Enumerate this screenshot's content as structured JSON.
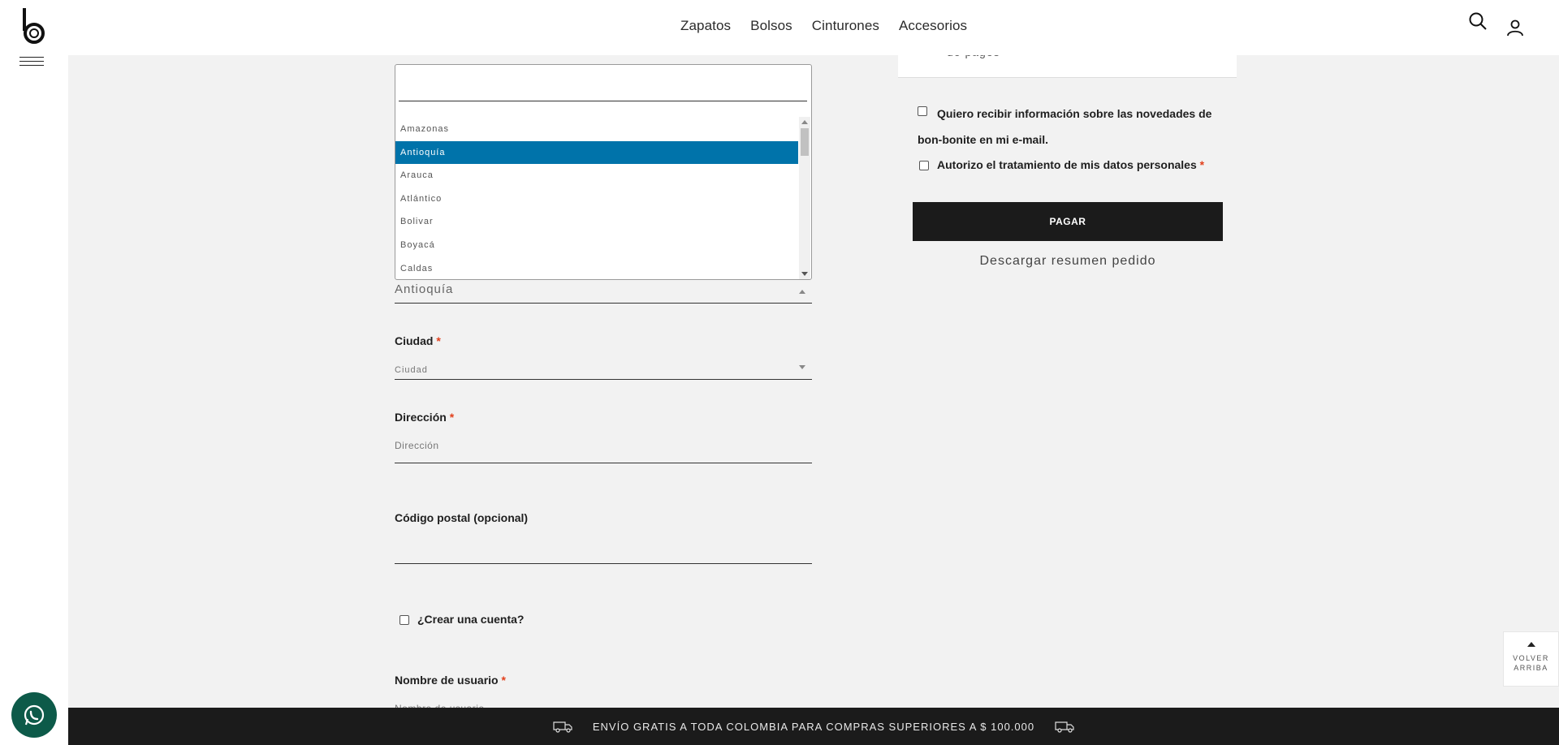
{
  "nav": {
    "items": [
      "Zapatos",
      "Bolsos",
      "Cinturones",
      "Accesorios"
    ]
  },
  "dropdown": {
    "options": [
      "Amazonas",
      "Antioquía",
      "Arauca",
      "Atlántico",
      "Bolivar",
      "Boyacá",
      "Caldas"
    ],
    "active_index": 1
  },
  "form": {
    "departamento_value": "Antioquía",
    "ciudad_label": "Ciudad",
    "ciudad_value": "Ciudad",
    "direccion_label": "Dirección",
    "direccion_placeholder": "Dirección",
    "postal_label": "Código postal (opcional)",
    "crear_cuenta": "¿Crear una cuenta?",
    "usuario_label": "Nombre de usuario",
    "usuario_placeholder": "Nombre de usuario",
    "required_mark": "*"
  },
  "summary": {
    "partial_text": "de pagos",
    "newsletter": "Quiero recibir información sobre las novedades de bon-bonite en mi e-mail.",
    "privacy": "Autorizo el tratamiento de mis datos personales",
    "pay_button": "PAGAR",
    "download": "Descargar resumen pedido"
  },
  "back_to_top": {
    "line1": "VOLVER",
    "line2": "ARRIBA"
  },
  "ship_bar": {
    "text": "ENVÍO GRATIS A TODA COLOMBIA PARA COMPRAS SUPERIORES A $ 100.000"
  }
}
